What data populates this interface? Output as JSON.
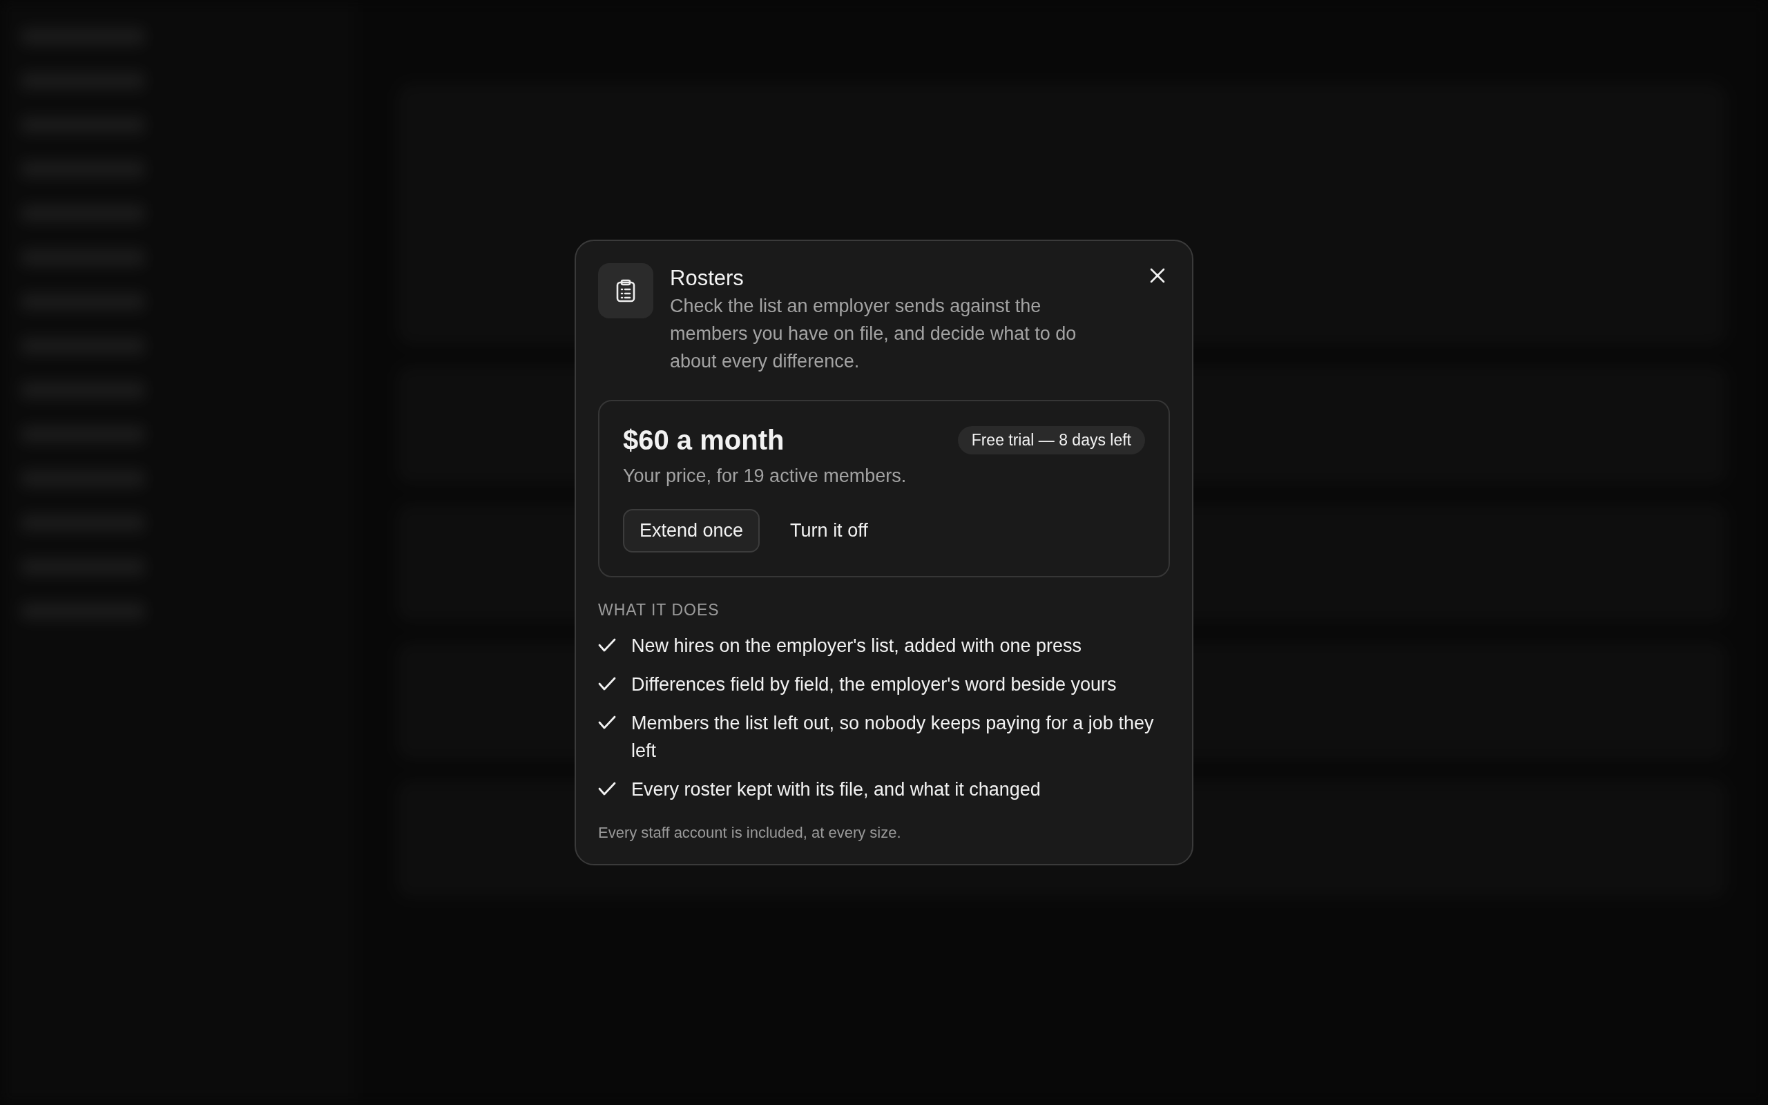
{
  "dialog": {
    "title": "Rosters",
    "description": "Check the list an employer sends against the members you have on file, and decide what to do about every difference.",
    "plan": {
      "price": "$60 a month",
      "badge": "Free trial — 8 days left",
      "note": "Your price, for 19 active members.",
      "buttons": [
        {
          "label": "Extend once",
          "kind": "outlined"
        },
        {
          "label": "Turn it off",
          "kind": "plain"
        }
      ]
    },
    "features_heading": "WHAT IT DOES",
    "features": [
      {
        "text": "New hires on the employer's list, added with one press"
      },
      {
        "text": "Differences field by field, the employer's word beside yours"
      },
      {
        "text": "Members the list left out, so nobody keeps paying for a job they left"
      },
      {
        "text": "Every roster kept with its file, and what it changed"
      }
    ],
    "footnote": "Every staff account is included, at every size."
  }
}
